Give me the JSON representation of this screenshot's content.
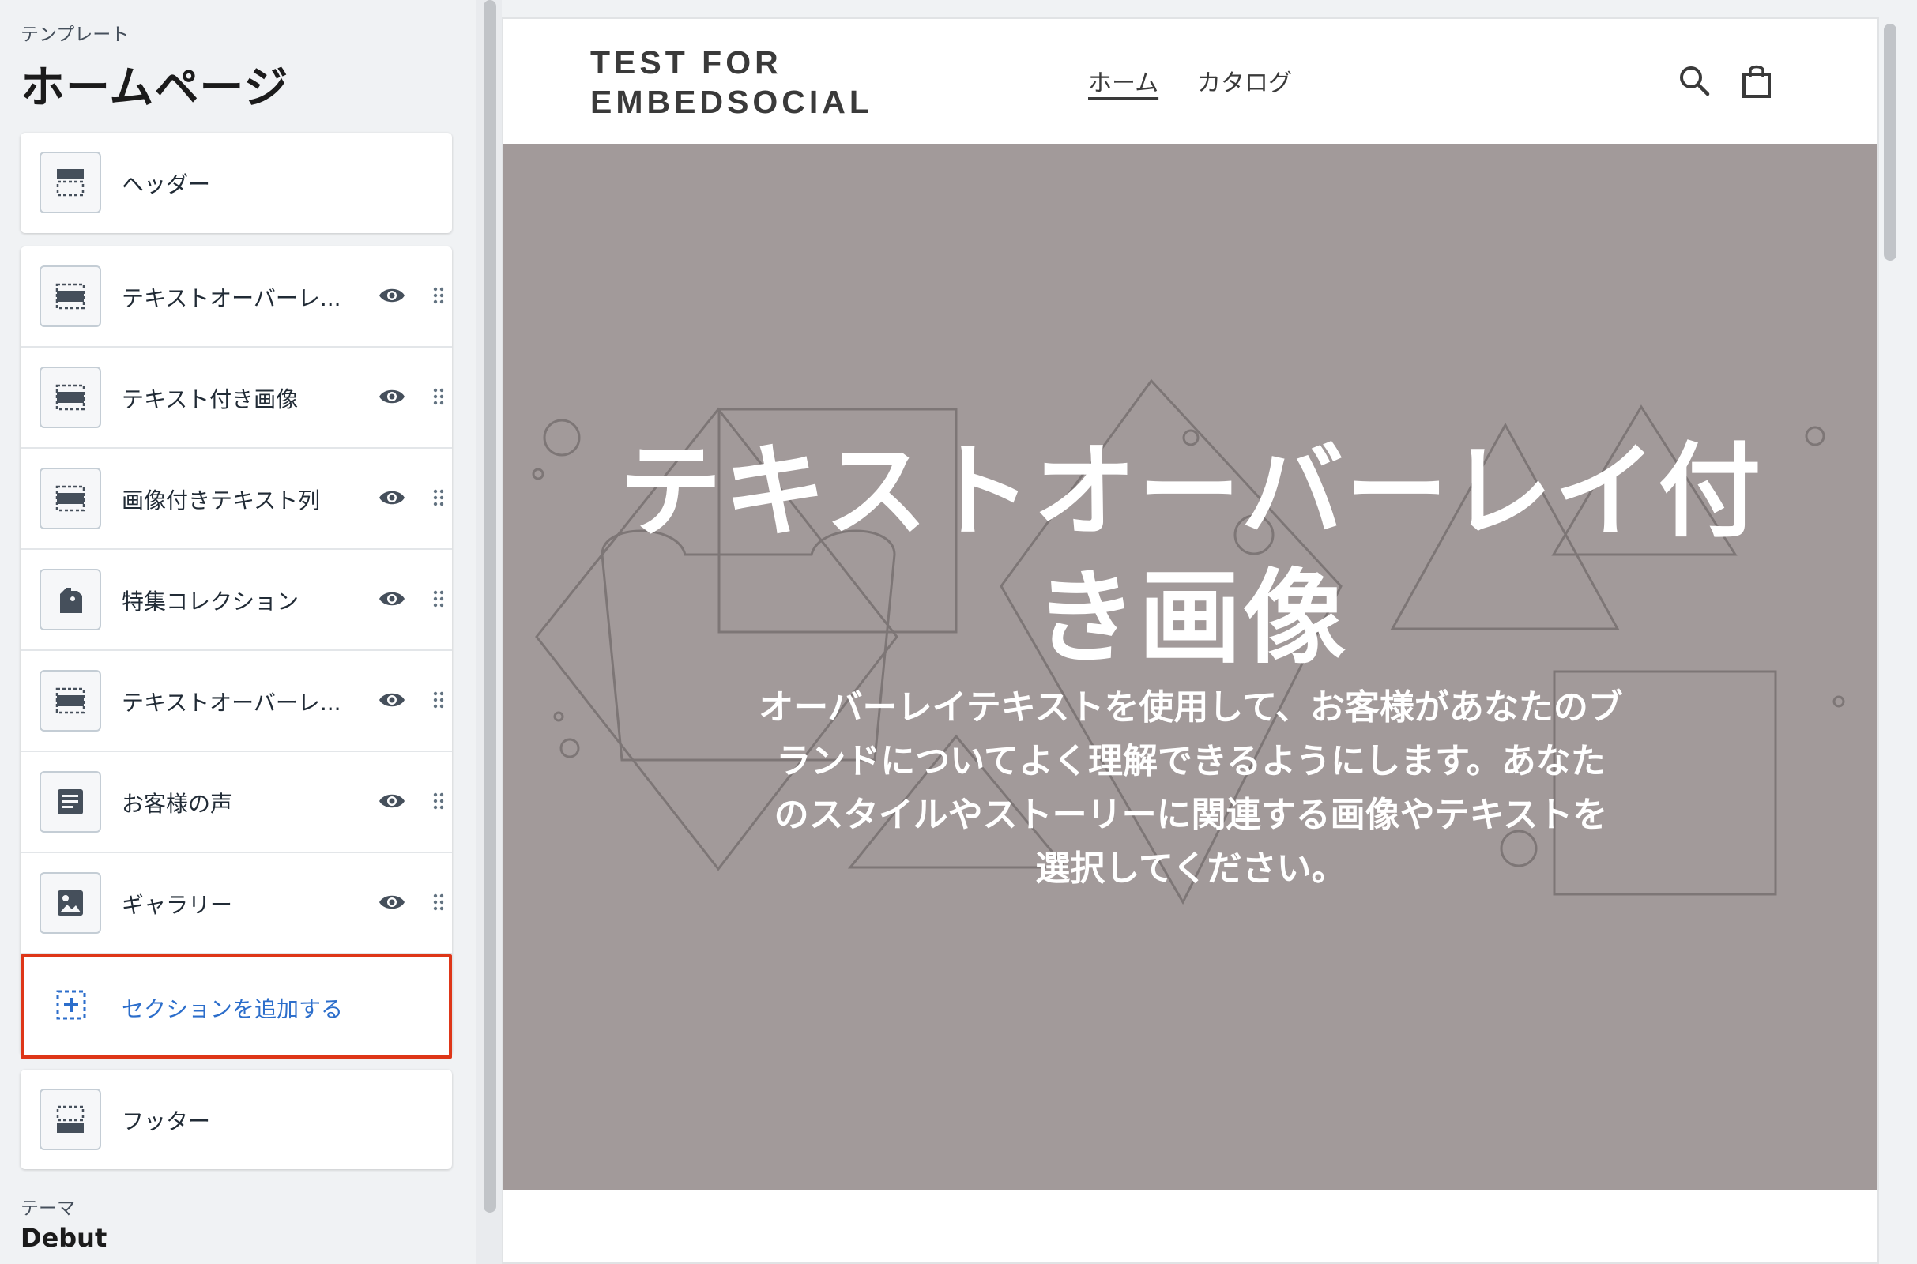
{
  "sidebar": {
    "template_label": "テンプレート",
    "template_title": "ホームページ",
    "header_item": {
      "label": "ヘッダー",
      "icon": "header-layout-icon"
    },
    "sections": [
      {
        "label": "テキストオーバーレ...",
        "icon": "section-layout-icon"
      },
      {
        "label": "テキスト付き画像",
        "icon": "section-layout-icon"
      },
      {
        "label": "画像付きテキスト列",
        "icon": "section-layout-icon"
      },
      {
        "label": "特集コレクション",
        "icon": "tag-icon"
      },
      {
        "label": "テキストオーバーレ...",
        "icon": "section-layout-icon"
      },
      {
        "label": "お客様の声",
        "icon": "text-block-icon"
      },
      {
        "label": "ギャラリー",
        "icon": "image-icon"
      }
    ],
    "add_section_label": "セクションを追加する",
    "footer_item": {
      "label": "フッター",
      "icon": "footer-layout-icon"
    },
    "theme_label": "テーマ",
    "theme_name": "Debut"
  },
  "preview": {
    "store_name_line1": "TEST FOR",
    "store_name_line2": "EMBEDSOCIAL",
    "nav": {
      "home": "ホーム",
      "catalog": "カタログ"
    },
    "hero": {
      "title_line1": "テキストオーバーレイ付",
      "title_line2": "き画像",
      "text_line1": "オーバーレイテキストを使用して、お客様があなたのブ",
      "text_line2": "ランドについてよく理解できるようにします。あなた",
      "text_line3": "のスタイルやストーリーに関連する画像やテキストを",
      "text_line4": "選択してください。"
    }
  },
  "colors": {
    "highlight_border": "#de3618",
    "link": "#2c6ecb",
    "hero_bg": "#a29a9a"
  }
}
